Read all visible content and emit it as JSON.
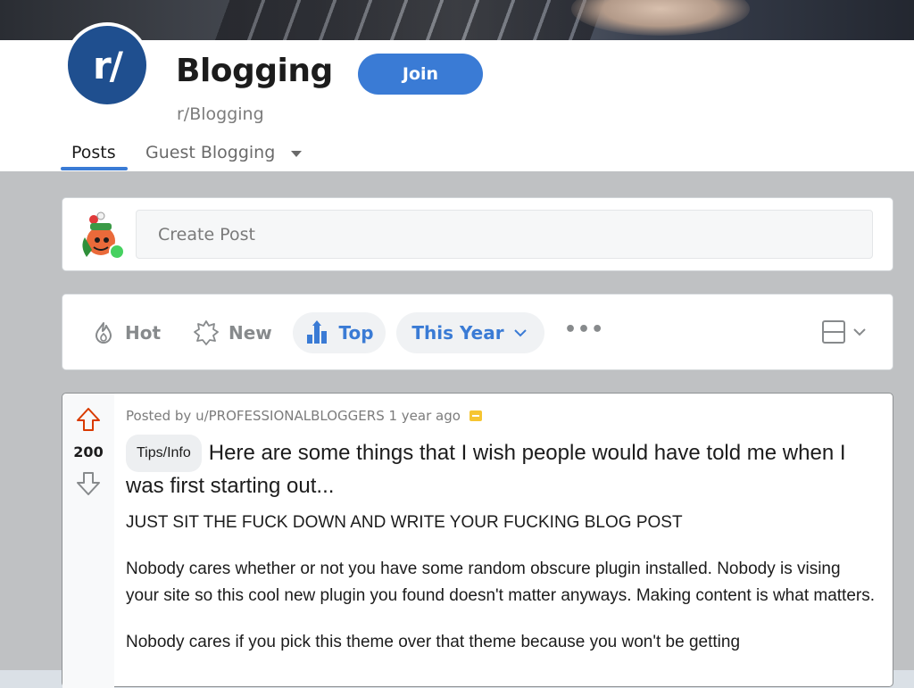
{
  "subreddit": {
    "avatar_text": "r/",
    "title": "Blogging",
    "name": "r/Blogging",
    "join_label": "Join"
  },
  "tabs": [
    {
      "label": "Posts",
      "active": true
    },
    {
      "label": "Guest Blogging",
      "has_dropdown": true
    }
  ],
  "create_post": {
    "placeholder": "Create Post"
  },
  "sort": {
    "hot": "Hot",
    "new": "New",
    "top": "Top",
    "time_range": "This Year",
    "more": "•••"
  },
  "post": {
    "votes": "200",
    "meta": "Posted by u/PROFESSIONALBLOGGERS 1 year ago",
    "flair": "Tips/Info",
    "title": "Here are some things that I wish people would have told me when I was first starting out...",
    "body": [
      "JUST SIT THE FUCK DOWN AND WRITE YOUR FUCKING BLOG POST",
      "Nobody cares whether or not you have some random obscure plugin installed. Nobody is vising your site so this cool new plugin you found doesn't matter anyways. Making content is what matters.",
      "Nobody cares if you pick this theme over that theme because you won't be getting"
    ]
  },
  "colors": {
    "accent": "#3a7bd5",
    "upvote": "#d93a00",
    "online": "#46d160",
    "page_bg": "#bfc1c3"
  },
  "icons": [
    "flame-icon",
    "new-burst-icon",
    "top-chart-icon",
    "chevron-down-icon",
    "layout-card-icon",
    "upvote-arrow-icon",
    "downvote-arrow-icon",
    "award-icon"
  ]
}
